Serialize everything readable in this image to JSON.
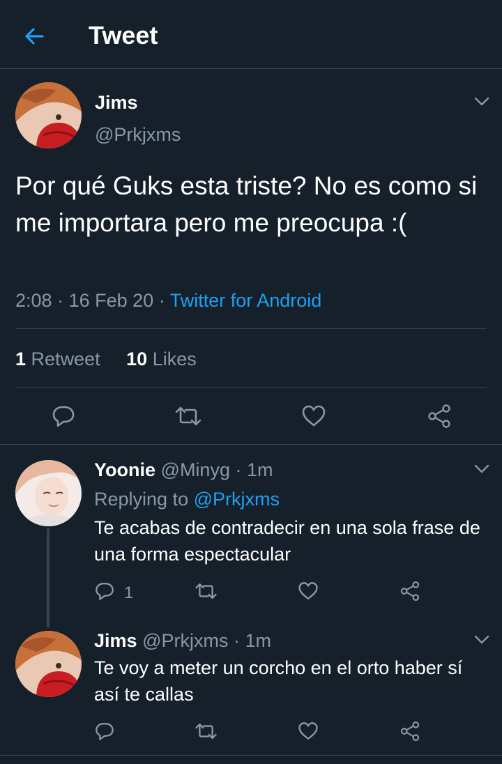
{
  "header": {
    "title": "Tweet",
    "back_icon": "back-arrow-icon"
  },
  "colors": {
    "background": "#15202b",
    "accent": "#1da1f2",
    "muted": "#8899a6",
    "divider": "#38444d"
  },
  "main_tweet": {
    "display_name": "Jims",
    "handle": "@Prkjxms",
    "text": "Por qué Guks esta triste? No es como si me importara pero me preocupa :(",
    "time": "2:08",
    "date": "16 Feb 20",
    "source": "Twitter for Android",
    "retweet_count": "1",
    "retweet_label": "Retweet",
    "like_count": "10",
    "like_label": "Likes"
  },
  "replies": [
    {
      "display_name": "Yoonie",
      "handle": "@Minyg",
      "time": "1m",
      "replying_label": "Replying to",
      "replying_to": "@Prkjxms",
      "text": "Te acabas de contradecir en una sola frase de una forma espectacular",
      "reply_count": "1"
    },
    {
      "display_name": "Jims",
      "handle": "@Prkjxms",
      "time": "1m",
      "text": "Te voy a meter un corcho en el orto haber sí así te callas"
    }
  ]
}
